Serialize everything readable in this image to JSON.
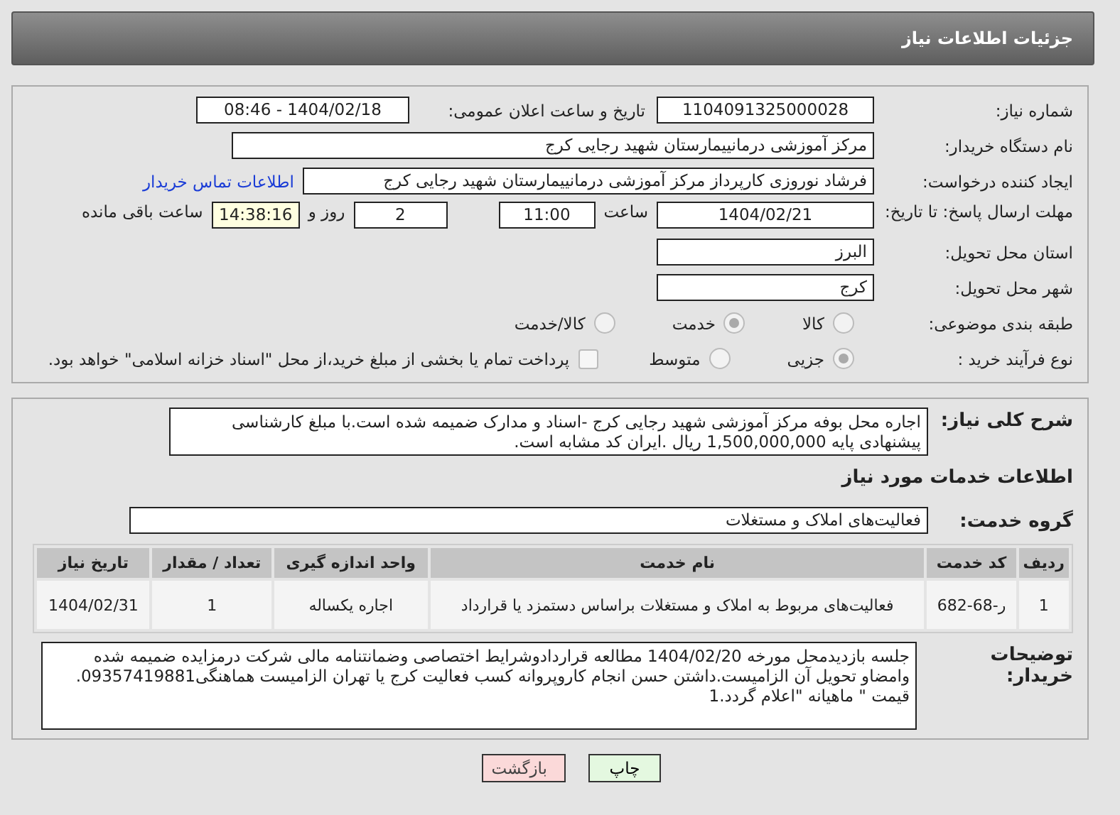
{
  "header": {
    "title": "جزئیات اطلاعات نیاز"
  },
  "need_number": {
    "label": "شماره نیاز:",
    "value": "1104091325000028"
  },
  "announce": {
    "label": "تاریخ و ساعت اعلان عمومی:",
    "value": "1404/02/18 - 08:46"
  },
  "buyer_org": {
    "label": "نام دستگاه خریدار:",
    "value": "مرکز آموزشی درمانییمارستان شهید رجایی کرج"
  },
  "creator": {
    "label": "ایجاد کننده درخواست:",
    "value": "فرشاد نوروزی کارپرداز مرکز آموزشی درمانییمارستان شهید رجایی کرج",
    "link": "اطلاعات تماس خریدار"
  },
  "deadline": {
    "label": "مهلت ارسال پاسخ: تا تاریخ:",
    "date": "1404/02/21",
    "time_label": "ساعت",
    "time": "11:00",
    "days": "2",
    "days_label": "روز و",
    "remaining": "14:38:16",
    "remaining_label": "ساعت باقی مانده"
  },
  "province": {
    "label": "استان محل تحویل:",
    "value": "البرز"
  },
  "city": {
    "label": "شهر محل تحویل:",
    "value": "کرج"
  },
  "category": {
    "label": "طبقه بندی موضوعی:",
    "options": [
      {
        "label": "کالا",
        "selected": false
      },
      {
        "label": "خدمت",
        "selected": true
      },
      {
        "label": "کالا/خدمت",
        "selected": false
      }
    ]
  },
  "process": {
    "label": "نوع فرآیند خرید :",
    "options": [
      {
        "label": "جزیی",
        "selected": true
      },
      {
        "label": "متوسط",
        "selected": false
      }
    ],
    "payment": {
      "checked": false,
      "label": "پرداخت تمام یا بخشی از مبلغ خرید،از محل \"اسناد خزانه اسلامی\" خواهد بود."
    }
  },
  "description": {
    "label": "شرح کلی نیاز:",
    "value": "اجاره محل بوفه مرکز آموزشی شهید رجایی کرج -اسناد و مدارک ضمیمه شده است.با مبلغ کارشناسی پیشنهادی پایه 1,500,000,000 ریال .ایران کد مشابه است."
  },
  "services_title": "اطلاعات خدمات مورد نیاز",
  "service_group": {
    "label": "گروه خدمت:",
    "value": "فعالیت‌های  املاک و مستغلات"
  },
  "table": {
    "columns": [
      "ردیف",
      "کد خدمت",
      "نام خدمت",
      "واحد اندازه گیری",
      "تعداد / مقدار",
      "تاریخ نیاز"
    ],
    "rows": [
      [
        "1",
        "ر-68-682",
        "فعالیت‌های مربوط به املاک و مستغلات براساس دستمزد یا قرارداد",
        "اجاره یکساله",
        "1",
        "1404/02/31"
      ]
    ]
  },
  "buyer_notes": {
    "label": "توضیحات خریدار:",
    "value": "جلسه بازدیدمحل مورخه 1404/02/20 مطالعه قراردادوشرایط اختصاصی وضمانتنامه مالی شرکت درمزایده ضمیمه شده وامضاو تحویل آن الزامیست.داشتن حسن انجام کاروپروانه کسب فعالیت کرج یا تهران الزامیست هماهنگی09357419881. قیمت \" ماهیانه \"اعلام گردد.1"
  },
  "buttons": [
    {
      "label": "چاپ",
      "kind": "print"
    },
    {
      "label": "بازگشت",
      "kind": "back"
    }
  ]
}
